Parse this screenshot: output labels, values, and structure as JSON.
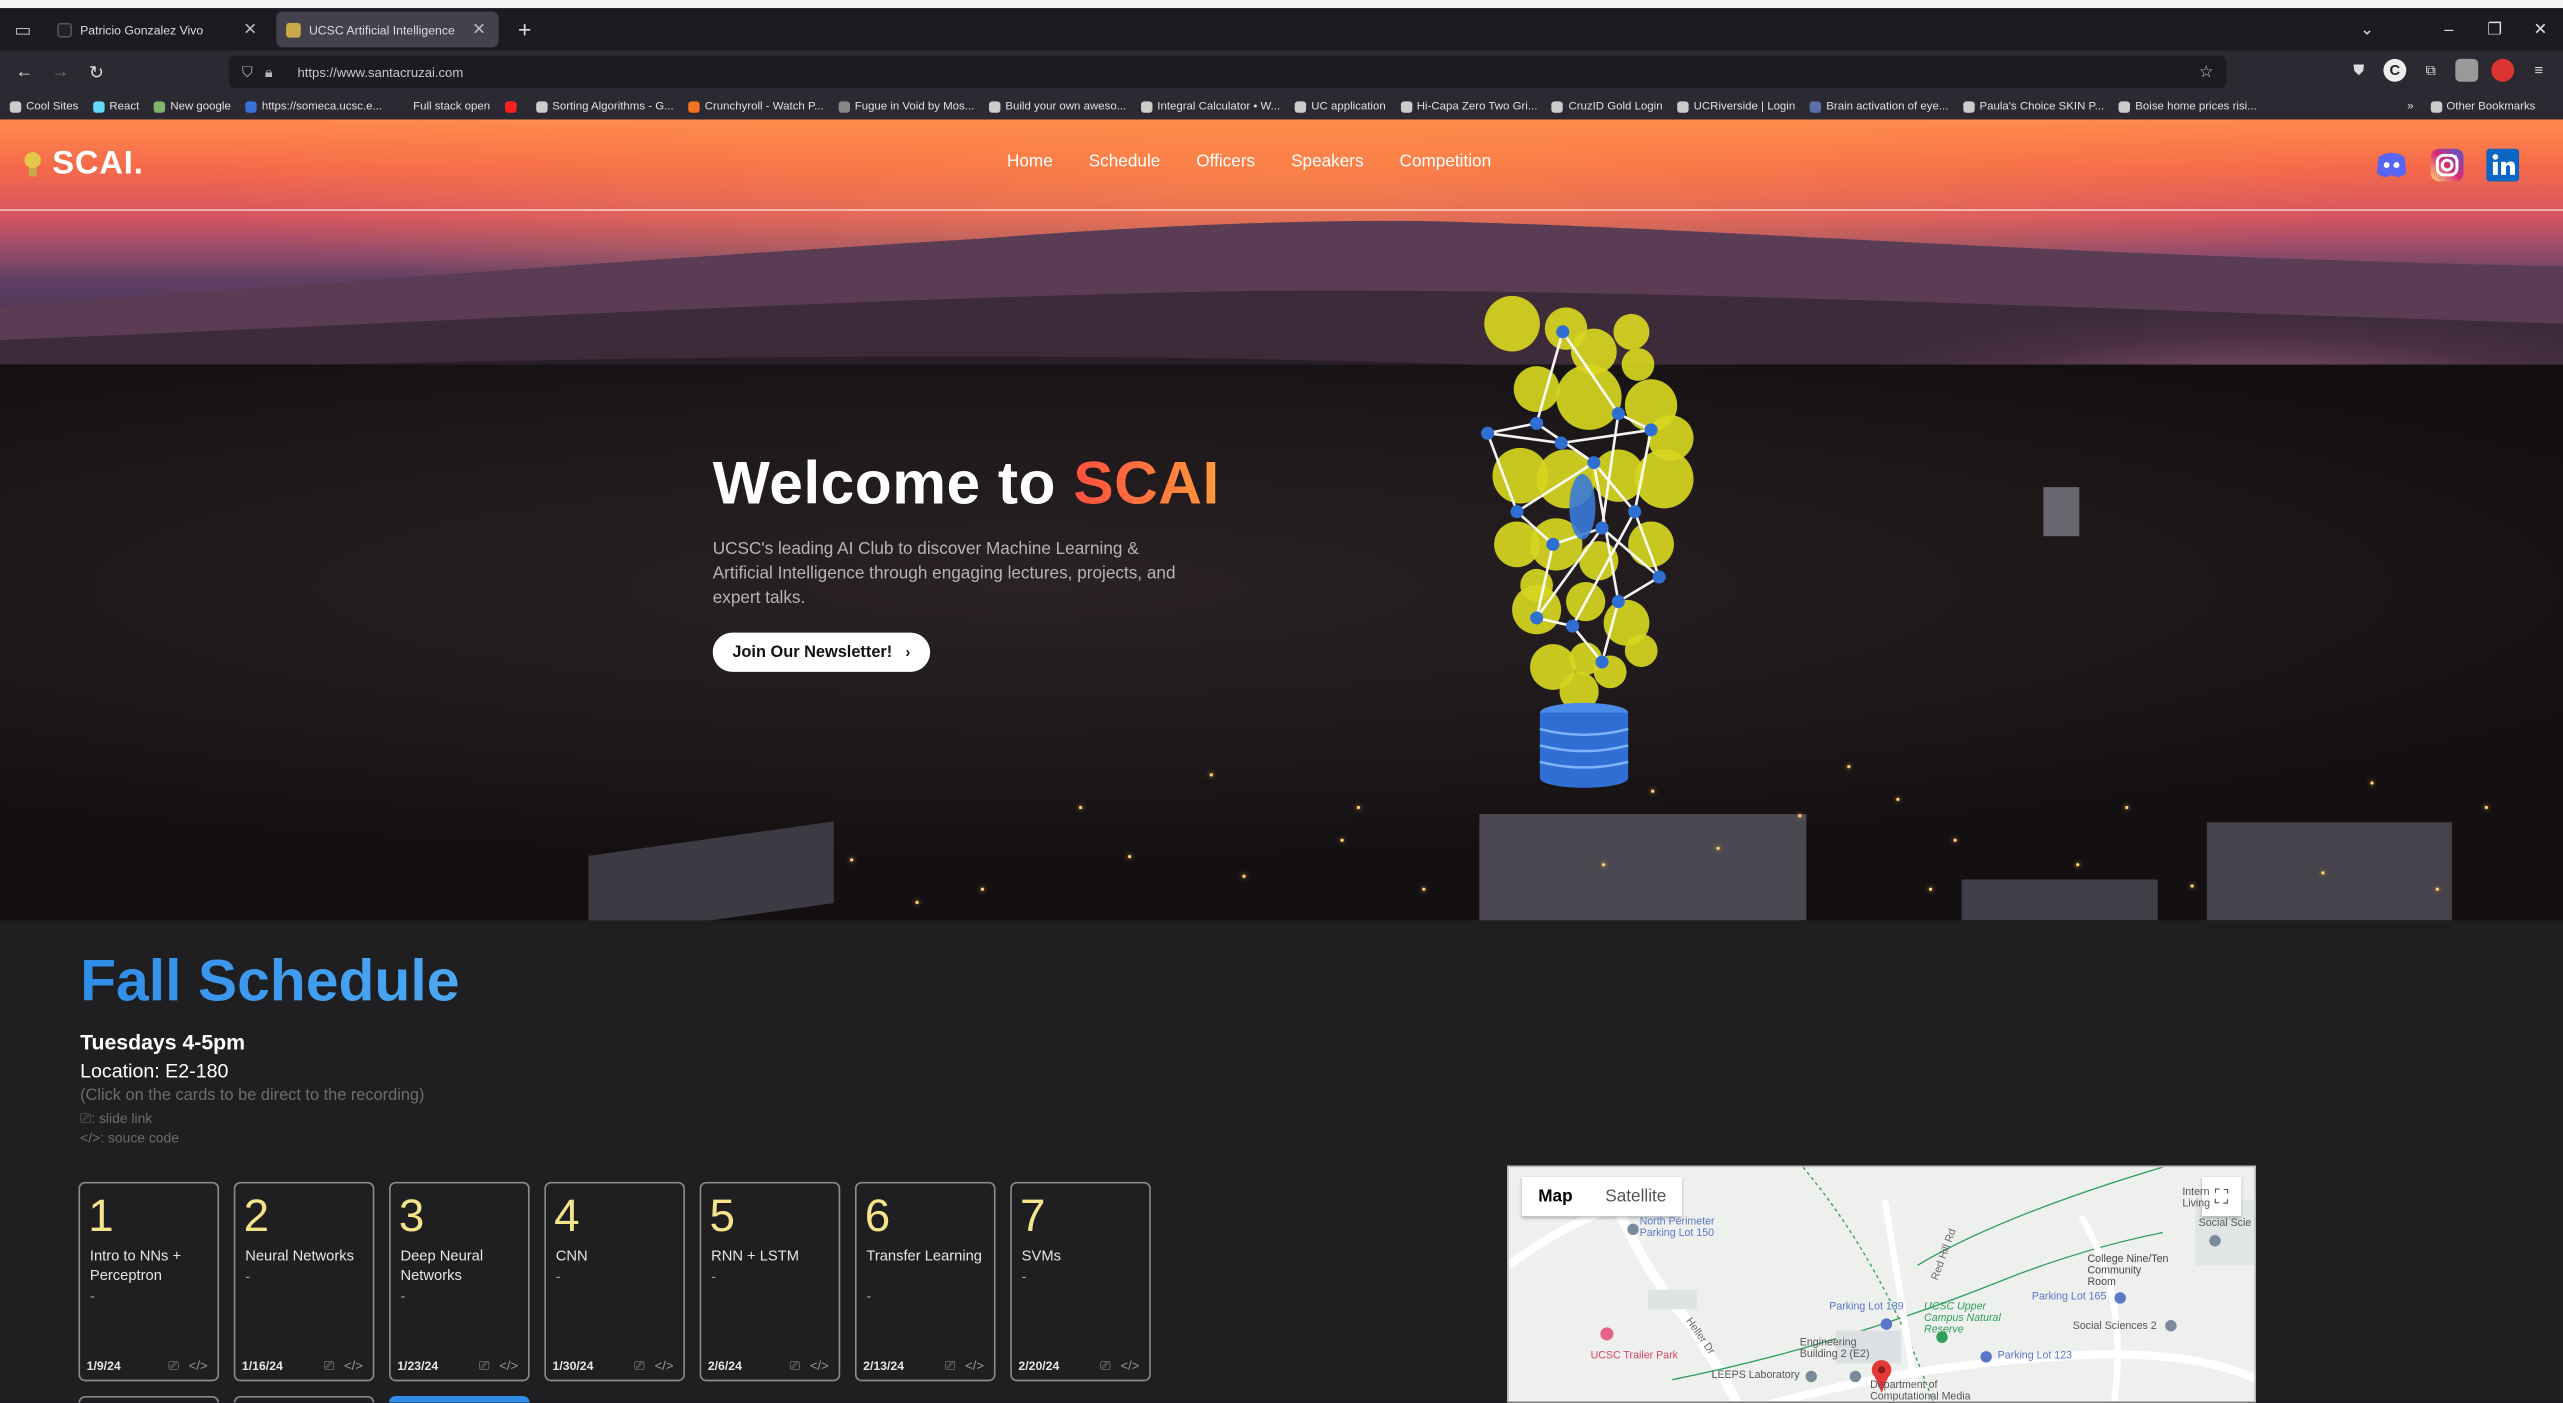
{
  "browser": {
    "tabs": [
      {
        "title": "Patricio Gonzalez Vivo",
        "active": false,
        "favicon_color": "#222222"
      },
      {
        "title": "UCSC Artificial Intelligence",
        "active": true,
        "favicon_color": "#c9a94a"
      }
    ],
    "url": "https://www.santacruzai.com",
    "bookmarks": [
      {
        "label": "Cool Sites",
        "icon": "folder-icon",
        "color": "#cccccc"
      },
      {
        "label": "React",
        "icon": "react-icon",
        "color": "#61dafb"
      },
      {
        "label": "New google",
        "icon": "image-icon",
        "color": "#7fb36c"
      },
      {
        "label": "https://someca.ucsc.e...",
        "icon": "ucsc-icon",
        "color": "#3a6fd8"
      },
      {
        "label": "Full stack open",
        "icon": "blank-icon",
        "color": "#2b2a33"
      },
      {
        "label": "",
        "icon": "youtube-icon",
        "color": "#ff2020"
      },
      {
        "label": "Sorting Algorithms - G...",
        "icon": "globe-icon",
        "color": "#cccccc"
      },
      {
        "label": "Crunchyroll - Watch P...",
        "icon": "crunchyroll-icon",
        "color": "#f47521"
      },
      {
        "label": "Fugue in Void by Mos...",
        "icon": "music-icon",
        "color": "#888888"
      },
      {
        "label": "Build your own aweso...",
        "icon": "globe-icon",
        "color": "#cccccc"
      },
      {
        "label": "Integral Calculator • W...",
        "icon": "globe-icon",
        "color": "#cccccc"
      },
      {
        "label": "UC application",
        "icon": "globe-icon",
        "color": "#cccccc"
      },
      {
        "label": "Hi-Capa Zero Two Gri...",
        "icon": "globe-icon",
        "color": "#cccccc"
      },
      {
        "label": "CruzID Gold Login",
        "icon": "globe-icon",
        "color": "#cccccc"
      },
      {
        "label": "UCRiverside | Login",
        "icon": "globe-icon",
        "color": "#cccccc"
      },
      {
        "label": "Brain activation of eye...",
        "icon": "doc-icon",
        "color": "#5b6fa6"
      },
      {
        "label": "Paula's Choice SKIN P...",
        "icon": "globe-icon",
        "color": "#cccccc"
      },
      {
        "label": "Boise home prices risi...",
        "icon": "globe-icon",
        "color": "#cccccc"
      }
    ],
    "other_bookmarks": "Other Bookmarks"
  },
  "site": {
    "logo": "SCAI.",
    "menu": [
      "Home",
      "Schedule",
      "Officers",
      "Speakers",
      "Competition"
    ],
    "socials": [
      "discord-icon",
      "instagram-icon",
      "linkedin-icon"
    ],
    "hero": {
      "title_prefix": "Welcome to ",
      "title_accent": "SCAI",
      "subtitle": "UCSC's leading AI Club to discover Machine Learning & Artificial Intelligence through engaging lectures, projects, and expert talks.",
      "button": "Join Our Newsletter!"
    },
    "schedule": {
      "title": "Fall Schedule",
      "time": "Tuesdays 4-5pm",
      "location": "Location: E2-180",
      "note": "(Click on the cards to be direct to the recording)",
      "legend_slide": ": slide link",
      "legend_code": ": souce code",
      "cards": [
        {
          "num": "1",
          "title": "Intro to NNs + Perceptron",
          "dash": "-",
          "date": "1/9/24"
        },
        {
          "num": "2",
          "title": "Neural Networks",
          "dash": "-",
          "date": "1/16/24"
        },
        {
          "num": "3",
          "title": "Deep Neural Networks",
          "dash": "-",
          "date": "1/23/24"
        },
        {
          "num": "4",
          "title": "CNN",
          "dash": "-",
          "date": "1/30/24"
        },
        {
          "num": "5",
          "title": "RNN + LSTM",
          "dash": "-",
          "date": "2/6/24"
        },
        {
          "num": "6",
          "title": "Transfer Learning",
          "dash": "-",
          "date": "2/13/24"
        },
        {
          "num": "7",
          "title": "SVMs",
          "dash": "-",
          "date": "2/20/24"
        }
      ]
    },
    "map": {
      "tab_map": "Map",
      "tab_satellite": "Satellite",
      "labels": {
        "north_perimeter": "North Perimeter Parking Lot 150",
        "lot139": "Parking Lot 139",
        "upper_campus": "UCSC Upper Campus Natural Reserve",
        "lot165": "Parking Lot 165",
        "college_nine": "College Nine/Ten Community Room",
        "social_sciences": "Social Sciences 2",
        "trailer_park": "UCSC Trailer Park",
        "lot123": "Parking Lot 123",
        "engineering": "Engineering Building 2 (E2)",
        "leeps": "LEEPS Laboratory",
        "dept": "Department of Computational Media",
        "intern_living": "Intern Living",
        "social_sci_edge": "Social Scie",
        "road": "Red Hill Rd",
        "heller": "Heller Dr"
      }
    }
  }
}
